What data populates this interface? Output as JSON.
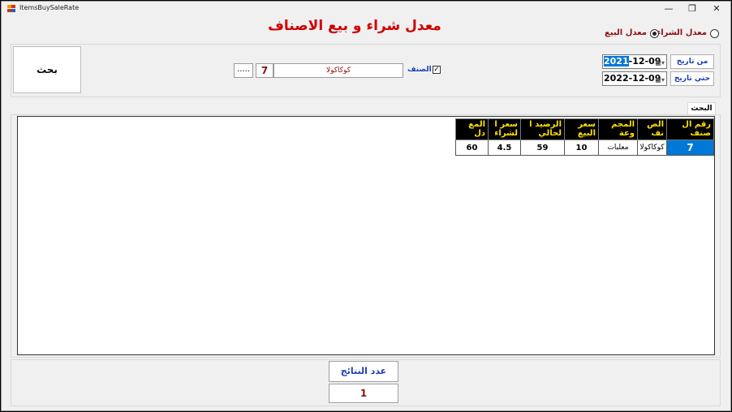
{
  "window": {
    "title": "ItemsBuySaleRate",
    "controls": {
      "minimize": "—",
      "maximize": "❐",
      "close": "✕"
    }
  },
  "header": {
    "title": "معدل شراء و بيع الاصناف"
  },
  "mode": {
    "buy_label": "معدل الشراء",
    "sale_label": "معدل البيع",
    "selected": "sale"
  },
  "filters": {
    "from_label": "من تاريخ",
    "to_label": "حتي تاريخ",
    "from_year": "2021",
    "from_rest": "-12-09",
    "to_date": "2022-12-09",
    "item_checkbox_label": "الصنف",
    "item_checked": true,
    "item_name": "كوكاكولا",
    "item_code": "7",
    "browse_label": "....."
  },
  "search_button": "بحث",
  "tab_label": "البحث",
  "grid": {
    "columns": [
      "رقم ال صنف",
      "الص نف",
      "المجم وعة",
      "سعر البيع",
      "الرصيد ا لحالي",
      "سعر ا لشراء",
      "المع دل"
    ],
    "rows": [
      [
        "7",
        "كوكاكولا",
        "معلبات",
        "10",
        "59",
        "4.5",
        "60"
      ]
    ]
  },
  "footer": {
    "count_label": "عدد النتائج",
    "count_value": "1"
  },
  "colors": {
    "title_red": "#d00000",
    "label_blue": "#1a3fb0",
    "header_yellow": "#ffe000",
    "selection_blue": "#0078d7"
  }
}
